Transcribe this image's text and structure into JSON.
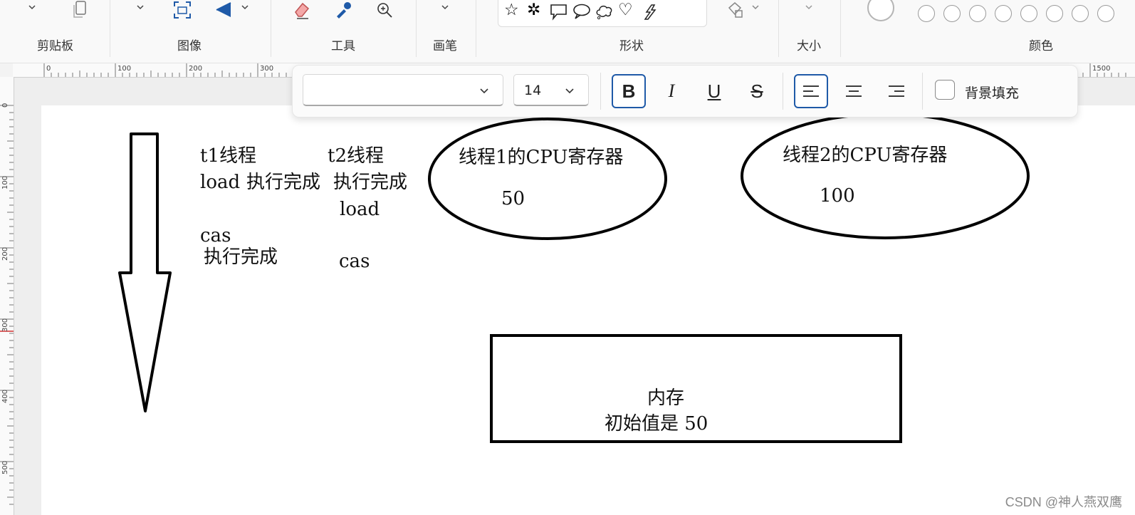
{
  "ribbon": {
    "groups": [
      "剪贴板",
      "图像",
      "工具",
      "画笔",
      "形状",
      "大小",
      "颜色"
    ],
    "shape_icons": [
      "☆",
      "✲",
      "rect-callout",
      "oval-callout",
      "cloud-callout",
      "♡",
      "lightning"
    ]
  },
  "ruler": {
    "top_labels": [
      "0",
      "100",
      "200",
      "300",
      "1500"
    ],
    "left_labels": [
      "0",
      "100",
      "200",
      "300",
      "400",
      "500"
    ]
  },
  "text_toolbar": {
    "font_name": "",
    "font_size": "14",
    "bold": "B",
    "italic": "I",
    "underline": "U",
    "strikethrough": "S",
    "background_fill_label": "背景填充"
  },
  "canvas": {
    "t1_header": "t1线程",
    "t2_header": "t2线程",
    "t1_load": "load",
    "t1_exec1": "执行完成",
    "t2_exec1": "执行完成",
    "t2_load": "load",
    "t1_cas": "cas",
    "t1_exec2": "执行完成",
    "t2_cas": "cas",
    "reg1_title": "线程1的CPU寄存器",
    "reg1_value": "50",
    "reg2_title": "线程2的CPU寄存器",
    "reg2_value": "100",
    "mem_title": "内存",
    "mem_value": "初始值是 50"
  },
  "watermark": "CSDN @神人燕双鹰",
  "colors": {
    "accent": "#1f5aa8",
    "ink": "#000000",
    "paper": "#ffffff"
  }
}
